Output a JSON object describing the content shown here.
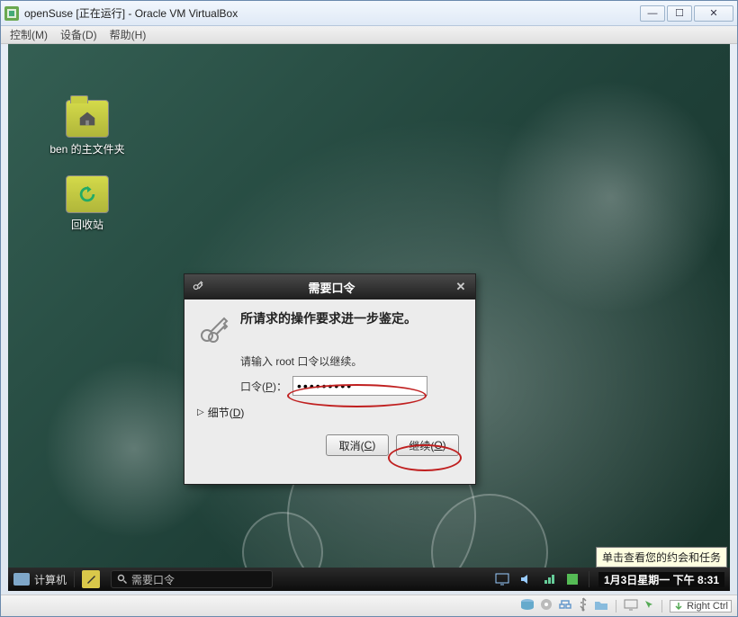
{
  "window": {
    "title": "openSuse [正在运行] - Oracle VM VirtualBox",
    "menu": {
      "control": "控制(M)",
      "devices": "设备(D)",
      "help": "帮助(H)"
    },
    "buttons": {
      "min": "—",
      "max": "☐",
      "close": "✕"
    }
  },
  "desktop": {
    "home_label": "ben 的主文件夹",
    "trash_label": "回收站"
  },
  "dialog": {
    "title": "需要口令",
    "heading": "所请求的操作要求进一步鉴定。",
    "message": "请输入 root 口令以继续。",
    "password_label_prefix": "口令(",
    "password_label_hotkey": "P",
    "password_label_suffix": ")：",
    "password_value": "●●●●●●●●●",
    "details_prefix": "细节(",
    "details_hotkey": "D",
    "details_suffix": ")",
    "cancel_prefix": "取消(",
    "cancel_hotkey": "C",
    "cancel_suffix": ")",
    "continue_prefix": "继续(",
    "continue_hotkey": "O",
    "continue_suffix": ")"
  },
  "tooltip": "单击查看您的约会和任务",
  "taskbar": {
    "menu_label": "计算机",
    "search_placeholder": "需要口令",
    "clock": "1月3日星期一 下午  8:31"
  },
  "statusbar": {
    "host_key": "Right Ctrl"
  }
}
